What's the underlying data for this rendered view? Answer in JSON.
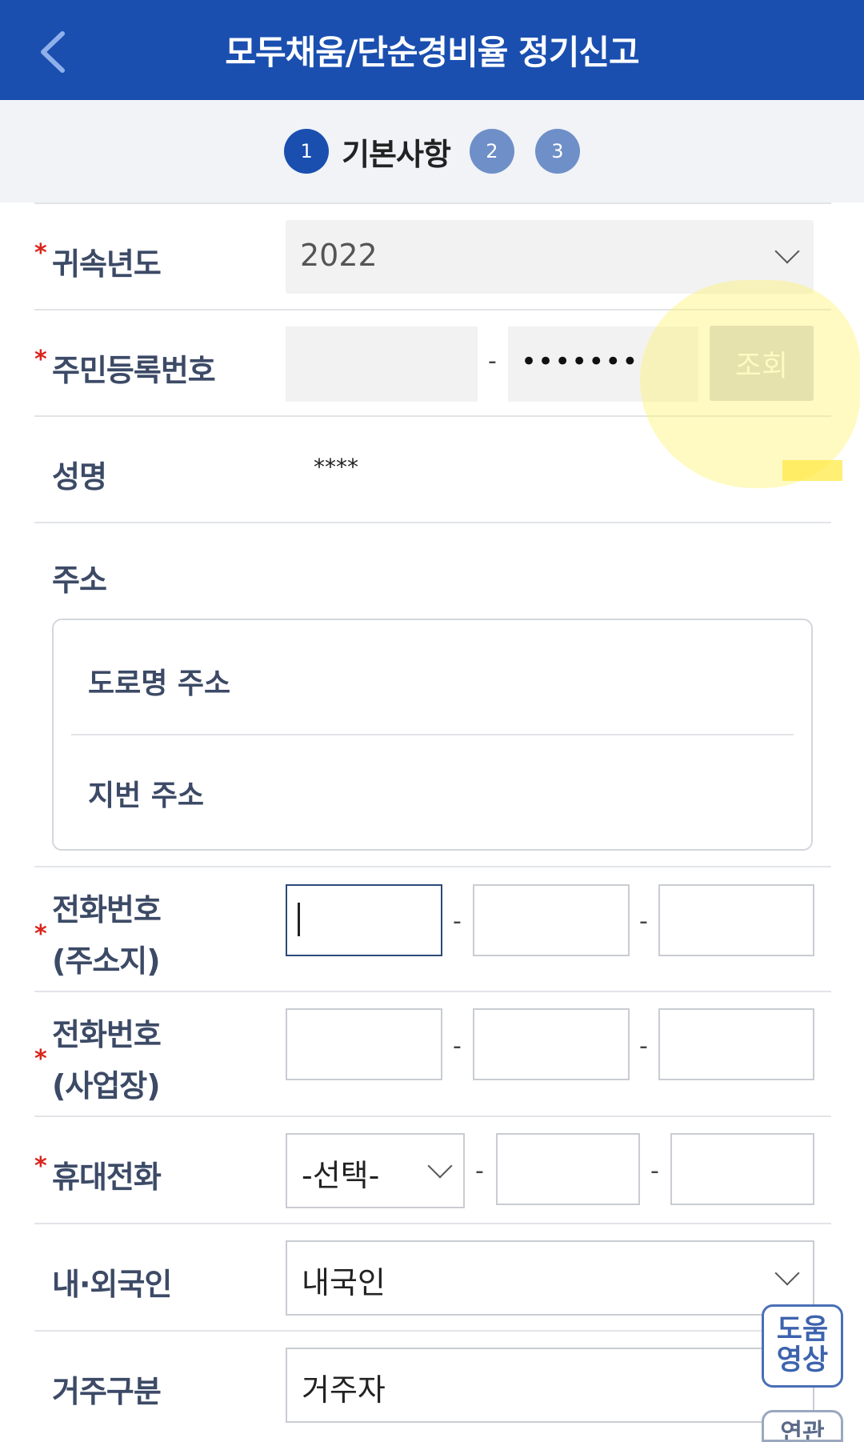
{
  "header": {
    "title": "모두채움/단순경비율 정기신고"
  },
  "steps": [
    {
      "number": "1",
      "label": "기본사항",
      "active": true
    },
    {
      "number": "2",
      "active": false
    },
    {
      "number": "3",
      "active": false
    }
  ],
  "form": {
    "year": {
      "label": "귀속년도",
      "value": "2022"
    },
    "resident_id": {
      "label": "주민등록번호",
      "part1": "",
      "separator": "-",
      "part2": "•••••••",
      "lookup_label": "조회"
    },
    "name": {
      "label": "성명",
      "value": "****"
    },
    "address": {
      "label": "주소",
      "road": "도로명 주소",
      "lot": "지번 주소"
    },
    "phone_home": {
      "label_line1": "전화번호",
      "label_line2": "(주소지)",
      "separator": "-"
    },
    "phone_business": {
      "label_line1": "전화번호",
      "label_line2": "(사업장)",
      "separator": "-"
    },
    "mobile": {
      "label": "휴대전화",
      "carrier_placeholder": "-선택-",
      "separator": "-"
    },
    "nationality": {
      "label": "내·외국인",
      "value": "내국인"
    },
    "residency": {
      "label": "거주구분",
      "value": "거주자"
    }
  },
  "floating": {
    "help_line1": "도움",
    "help_line2": "영상",
    "next_line1": "연관"
  },
  "colors": {
    "brand": "#1a4fb0",
    "required": "#d9251c",
    "highlight": "#fff46e"
  }
}
